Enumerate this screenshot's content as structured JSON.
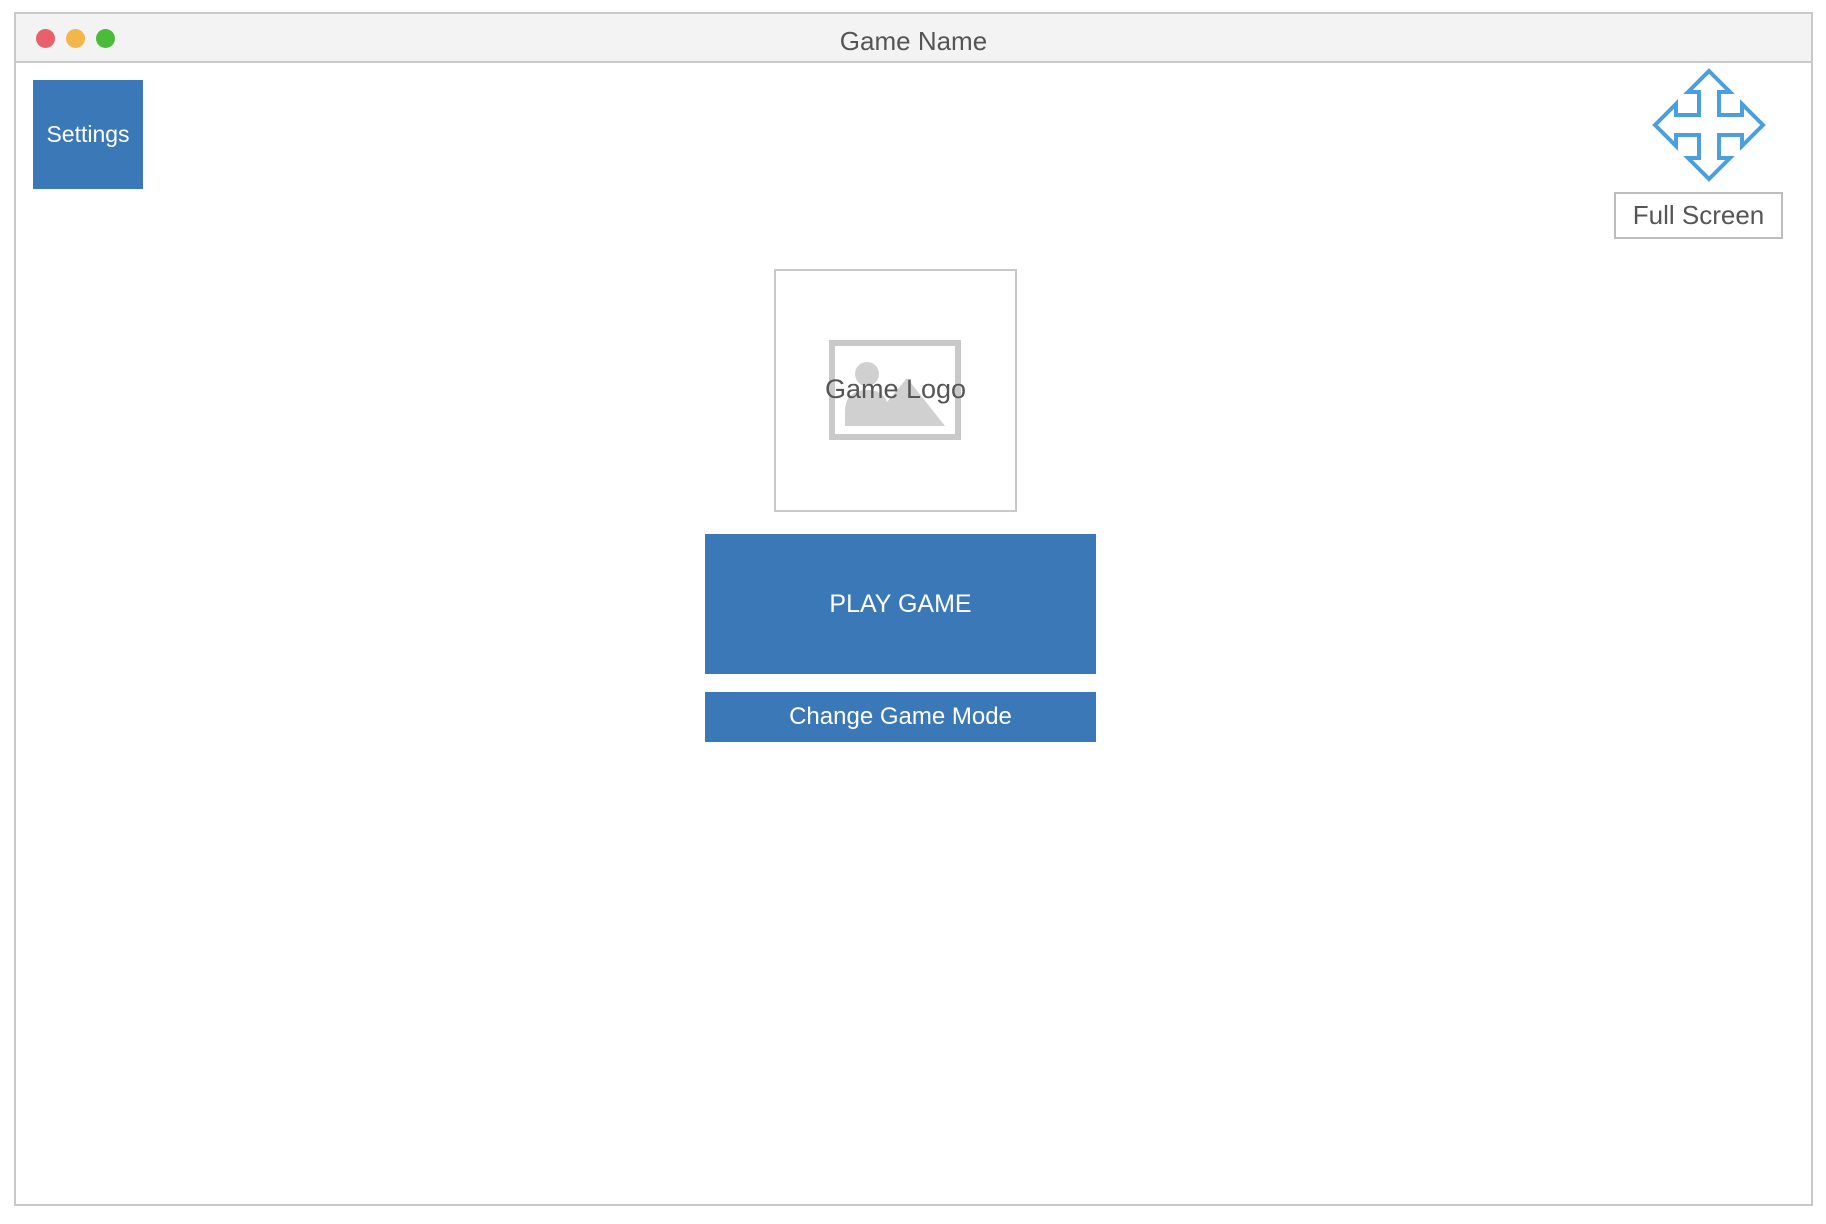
{
  "window": {
    "title": "Game Name",
    "traffic_lights": {
      "close_color": "#e8606a",
      "minimize_color": "#f2b64a",
      "maximize_color": "#4cbb3a"
    }
  },
  "toolbar": {
    "settings_label": "Settings",
    "fullscreen_icon": "move-arrows-icon",
    "fullscreen_label": "Full Screen"
  },
  "main": {
    "logo_icon": "image-placeholder-icon",
    "logo_label": "Game Logo",
    "play_label": "PLAY GAME",
    "change_mode_label": "Change Game Mode"
  },
  "colors": {
    "accent": "#3b78b7",
    "icon_blue": "#4a9fdc",
    "border": "#c9c9c9",
    "text": "#555555"
  }
}
